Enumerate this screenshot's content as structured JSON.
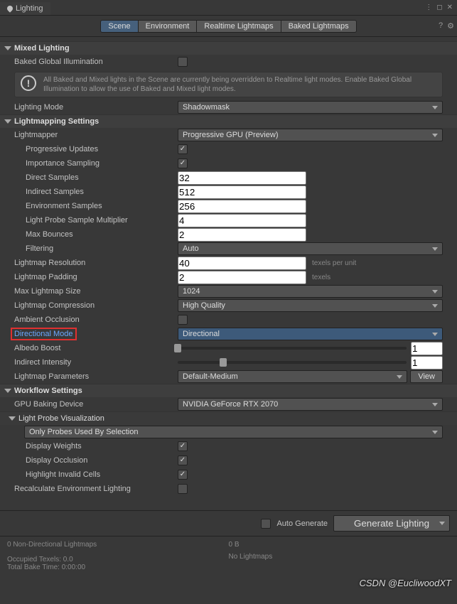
{
  "window": {
    "title": "Lighting"
  },
  "tabs": [
    "Scene",
    "Environment",
    "Realtime Lightmaps",
    "Baked Lightmaps"
  ],
  "sections": {
    "mixed": {
      "title": "Mixed Lighting",
      "baked_gi_label": "Baked Global Illumination",
      "info": "All Baked and Mixed lights in the Scene are currently being overridden to Realtime light modes. Enable Baked Global Illumination to allow the use of Baked and Mixed light modes.",
      "mode_label": "Lighting Mode",
      "mode_value": "Shadowmask"
    },
    "lmap": {
      "title": "Lightmapping Settings",
      "lightmapper_label": "Lightmapper",
      "lightmapper_value": "Progressive GPU (Preview)",
      "prog_updates": "Progressive Updates",
      "imp_sampling": "Importance Sampling",
      "direct_samples_label": "Direct Samples",
      "direct_samples": "32",
      "indirect_samples_label": "Indirect Samples",
      "indirect_samples": "512",
      "env_samples_label": "Environment Samples",
      "env_samples": "256",
      "lp_mult_label": "Light Probe Sample Multiplier",
      "lp_mult": "4",
      "max_bounces_label": "Max Bounces",
      "max_bounces": "2",
      "filtering_label": "Filtering",
      "filtering": "Auto",
      "res_label": "Lightmap Resolution",
      "res": "40",
      "res_unit": "texels per unit",
      "pad_label": "Lightmap Padding",
      "pad": "2",
      "pad_unit": "texels",
      "maxsize_label": "Max Lightmap Size",
      "maxsize": "1024",
      "comp_label": "Lightmap Compression",
      "comp": "High Quality",
      "ao_label": "Ambient Occlusion",
      "dirmode_label": "Directional Mode",
      "dirmode": "Directional",
      "albedo_label": "Albedo Boost",
      "albedo": "1",
      "indirect_label": "Indirect Intensity",
      "indirect": "1",
      "params_label": "Lightmap Parameters",
      "params": "Default-Medium",
      "view": "View"
    },
    "wf": {
      "title": "Workflow Settings",
      "gpu_label": "GPU Baking Device",
      "gpu": "NVIDIA GeForce RTX 2070",
      "lpv": "Light Probe Visualization",
      "lpv_mode": "Only Probes Used By Selection",
      "weights": "Display Weights",
      "occ": "Display Occlusion",
      "invalid": "Highlight Invalid Cells",
      "recalc": "Recalculate Environment Lighting"
    }
  },
  "footer": {
    "auto": "Auto Generate",
    "gen": "Generate Lighting"
  },
  "status": {
    "lm": "0 Non-Directional Lightmaps",
    "size": "0 B",
    "nolm": "No Lightmaps",
    "texels": "Occupied Texels: 0.0",
    "bake": "Total Bake Time: 0:00:00"
  },
  "watermark": "CSDN @EucliwoodXT"
}
